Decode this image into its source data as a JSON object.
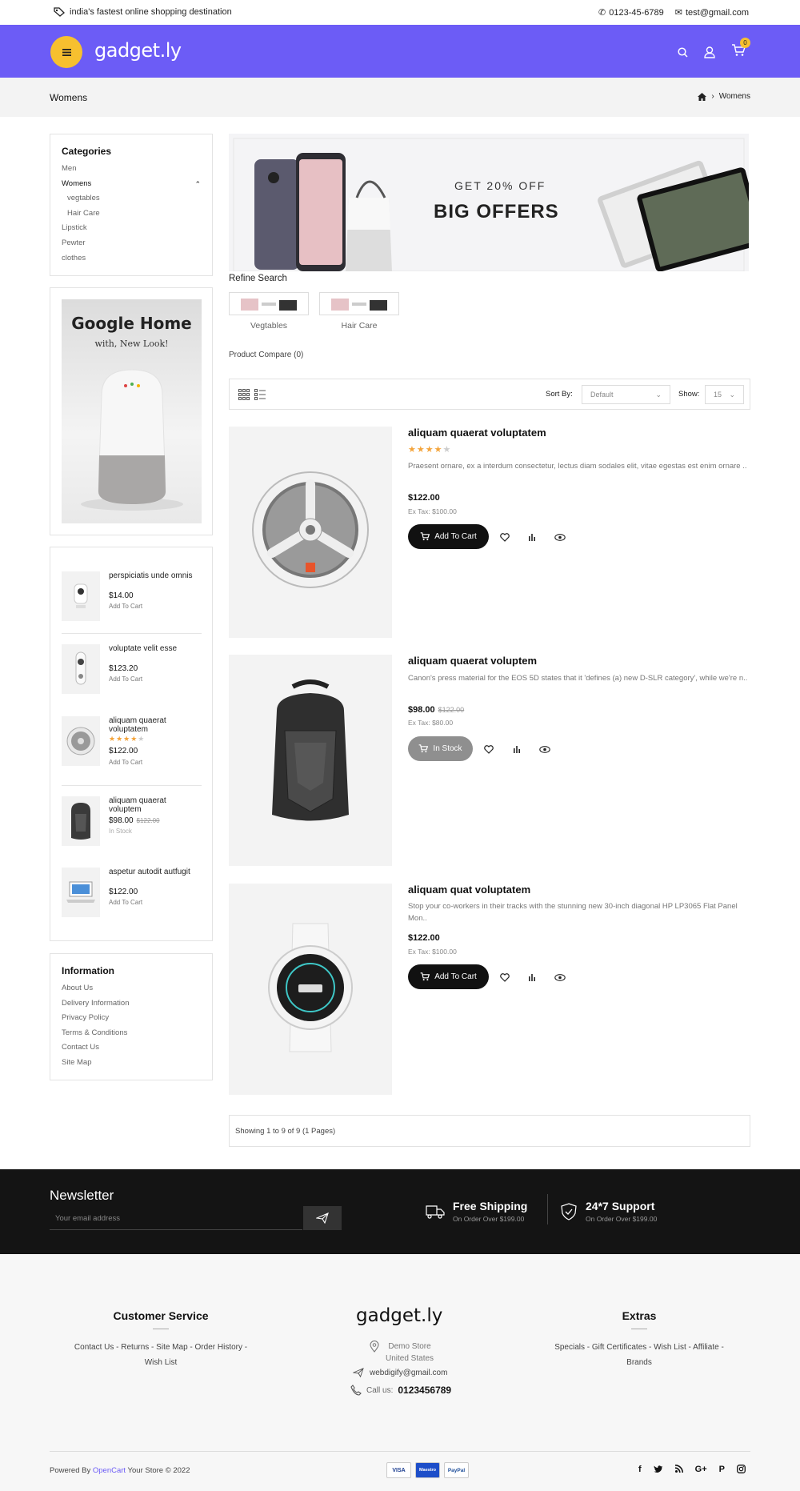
{
  "topbar": {
    "tagline": "india's fastest online shopping destination",
    "phone": "0123-45-6789",
    "email": "test@gmail.com"
  },
  "header": {
    "logo": "gadget.ly",
    "cart_count": "0"
  },
  "breadcrumb": {
    "title": "Womens",
    "current": "Womens"
  },
  "categories": {
    "title": "Categories",
    "items": [
      {
        "label": "Men"
      },
      {
        "label": "Womens"
      },
      {
        "label": "vegtables"
      },
      {
        "label": "Hair Care"
      },
      {
        "label": "Lipstick"
      },
      {
        "label": "Pewter"
      },
      {
        "label": "clothes"
      }
    ]
  },
  "promo": {
    "title": "Google Home",
    "subtitle": "with, New Look!"
  },
  "sidebar_products": [
    {
      "name": "perspiciatis unde omnis",
      "price": "$14.00",
      "action": "Add To Cart"
    },
    {
      "name": "voluptate velit esse",
      "price": "$123.20",
      "action": "Add To Cart"
    },
    {
      "name": "aliquam quaerat voluptatem",
      "price": "$122.00",
      "action": "Add To Cart",
      "rating": 4
    },
    {
      "name": "aliquam quaerat voluptem",
      "price": "$98.00",
      "old_price": "$122.00",
      "action": "In Stock"
    },
    {
      "name": "aspetur autodit autfugit",
      "price": "$122.00",
      "action": "Add To Cart"
    }
  ],
  "information": {
    "title": "Information",
    "items": [
      "About Us",
      "Delivery Information",
      "Privacy Policy",
      "Terms & Conditions",
      "Contact Us",
      "Site Map"
    ]
  },
  "banner": {
    "line1": "GET 20% OFF",
    "line2": "BIG OFFERS"
  },
  "refine": {
    "title": "Refine Search",
    "items": [
      "Vegtables",
      "Hair Care"
    ]
  },
  "compare": "Product Compare (0)",
  "toolbar": {
    "sort_label": "Sort By:",
    "sort_value": "Default",
    "show_label": "Show:",
    "show_value": "15"
  },
  "products": [
    {
      "name": "aliquam quaerat voluptatem",
      "rating": 4,
      "desc": "Praesent ornare, ex a interdum consectetur, lectus diam sodales elit, vitae egestas est enim ornare ..",
      "price": "$122.00",
      "tax": "Ex Tax: $100.00",
      "button": "Add To Cart"
    },
    {
      "name": "aliquam quaerat voluptem",
      "desc": "Canon's press material for the EOS 5D states that it 'defines (a) new D-SLR category', while we're n..",
      "price": "$98.00",
      "old_price": "$122.00",
      "tax": "Ex Tax: $80.00",
      "button": "In Stock"
    },
    {
      "name": "aliquam quat voluptatem",
      "desc": "Stop your co-workers in their tracks with the stunning new 30-inch diagonal HP LP3065 Flat Panel Mon..",
      "price": "$122.00",
      "tax": "Ex Tax: $100.00",
      "button": "Add To Cart"
    }
  ],
  "pagination": "Showing 1 to 9 of 9 (1 Pages)",
  "newsletter": {
    "title": "Newsletter",
    "placeholder": "Your email address"
  },
  "features": [
    {
      "title": "Free Shipping",
      "subtitle": "On Order Over $199.00"
    },
    {
      "title": "24*7 Support",
      "subtitle": "On Order Over $199.00"
    }
  ],
  "footer": {
    "customer_service": {
      "title": "Customer Service",
      "links": [
        "Contact Us",
        "Returns",
        "Site Map",
        "Order History",
        "Wish List"
      ]
    },
    "logo": "gadget.ly",
    "store": "Demo Store",
    "country": "United States",
    "email": "webdigify@gmail.com",
    "call_label": "Call us:",
    "call_number": "0123456789",
    "extras": {
      "title": "Extras",
      "links": [
        "Specials",
        "Gift Certificates",
        "Wish List",
        "Affiliate",
        "Brands"
      ]
    },
    "powered_prefix": "Powered By",
    "powered_link": "OpenCart",
    "powered_suffix": "Your Store © 2022",
    "payments": [
      "VISA",
      "Maestro",
      "PayPal"
    ],
    "social": [
      "f",
      "t",
      "rss",
      "G+",
      "p",
      "ig"
    ]
  }
}
